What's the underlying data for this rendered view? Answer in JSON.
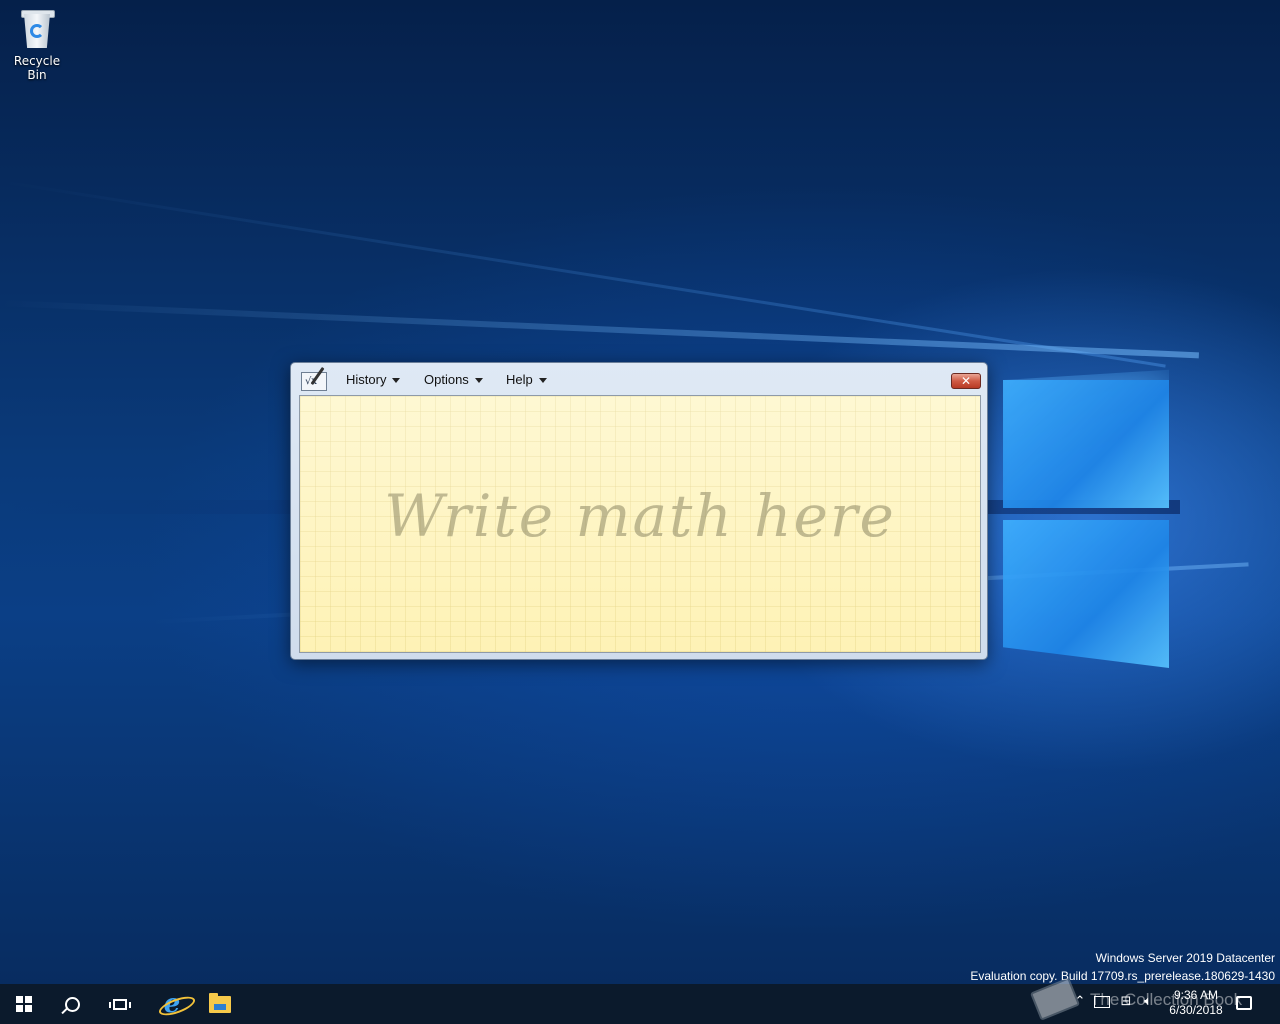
{
  "desktop": {
    "icons": [
      {
        "label": "Recycle Bin",
        "icon": "recycle-bin-icon"
      }
    ],
    "watermark": {
      "line1": "Windows Server 2019 Datacenter",
      "line2": "Evaluation copy. Build 17709.rs_prerelease.180629-1430"
    },
    "overlay_text": "The Collection Book"
  },
  "math_input_panel": {
    "app_icon": "math-input-panel-icon",
    "menu": [
      {
        "label": "History"
      },
      {
        "label": "Options"
      },
      {
        "label": "Help"
      }
    ],
    "close_glyph": "✕",
    "canvas_hint": "Write math here",
    "colors": {
      "canvas": "#fdf4c0",
      "close_button": "#cf5b45",
      "hint_text": "#8c8764"
    }
  },
  "taskbar": {
    "pinned": [
      {
        "name": "start",
        "icon": "windows-start-icon"
      },
      {
        "name": "search",
        "icon": "search-icon"
      },
      {
        "name": "task-view",
        "icon": "task-view-icon"
      },
      {
        "name": "internet-explorer",
        "icon": "internet-explorer-icon"
      },
      {
        "name": "file-explorer",
        "icon": "file-explorer-icon"
      }
    ],
    "tray": {
      "icons": [
        "show-hidden-icons-icon",
        "network-icon",
        "volume-icon",
        "notification-icon"
      ],
      "time": "9:36 AM",
      "date": "6/30/2018"
    },
    "background": "#0b1a2c"
  }
}
